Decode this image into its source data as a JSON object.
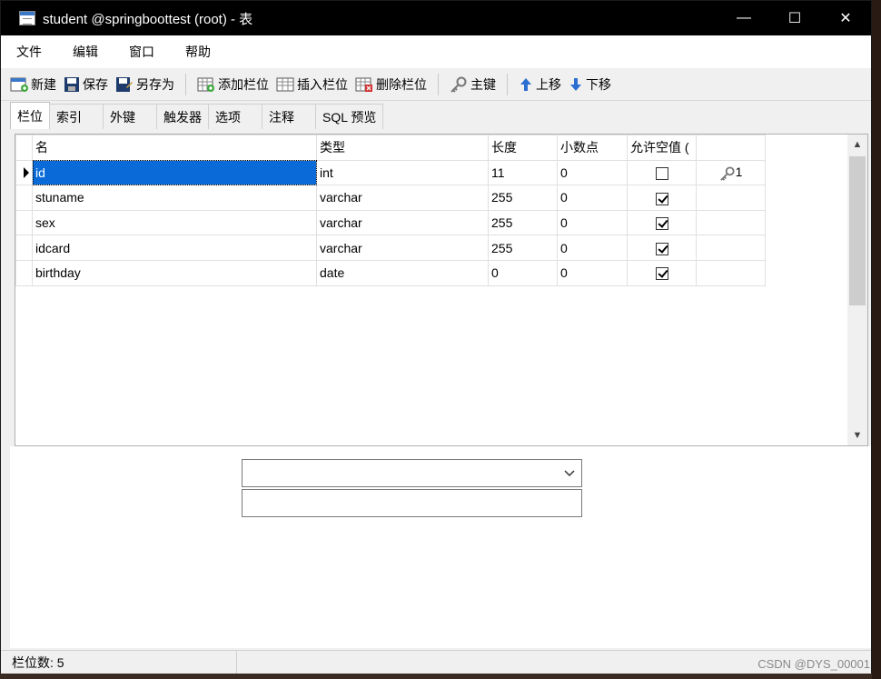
{
  "window": {
    "title": "student @springboottest (root) - 表",
    "controls": {
      "minimize": "—",
      "maximize": "☐",
      "close": "✕"
    }
  },
  "menu": [
    "文件",
    "编辑",
    "窗口",
    "帮助"
  ],
  "toolbar": {
    "new": "新建",
    "save": "保存",
    "save_as": "另存为",
    "add_column": "添加栏位",
    "insert_column": "插入栏位",
    "delete_column": "删除栏位",
    "primary_key": "主键",
    "move_up": "上移",
    "move_down": "下移"
  },
  "tabs": [
    "栏位",
    "索引",
    "外键",
    "触发器",
    "选项",
    "注释",
    "SQL 预览"
  ],
  "active_tab": "栏位",
  "grid": {
    "headers": [
      "名",
      "类型",
      "长度",
      "小数点",
      "允许空值 (",
      ""
    ],
    "rows": [
      {
        "name": "id",
        "type": "int",
        "length": "11",
        "decimals": "0",
        "nullable": false,
        "key": "1"
      },
      {
        "name": "stuname",
        "type": "varchar",
        "length": "255",
        "decimals": "0",
        "nullable": true,
        "key": ""
      },
      {
        "name": "sex",
        "type": "varchar",
        "length": "255",
        "decimals": "0",
        "nullable": true,
        "key": ""
      },
      {
        "name": "idcard",
        "type": "varchar",
        "length": "255",
        "decimals": "0",
        "nullable": true,
        "key": ""
      },
      {
        "name": "birthday",
        "type": "date",
        "length": "0",
        "decimals": "0",
        "nullable": true,
        "key": ""
      }
    ],
    "selected_row": 0
  },
  "status": {
    "column_count": "栏位数: 5"
  },
  "watermark": "CSDN @DYS_00001",
  "colors": {
    "selection": "#0a6bd8",
    "titlebar": "#000000"
  }
}
